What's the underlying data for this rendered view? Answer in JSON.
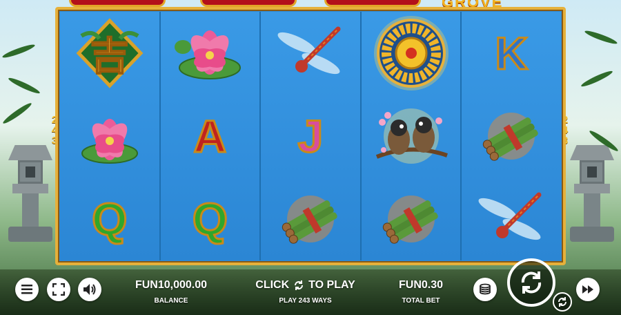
{
  "game": {
    "title_fragment": "GROVE",
    "ways_left": [
      "2",
      "4",
      "3"
    ],
    "ways_right": [
      "2",
      "4",
      "3"
    ]
  },
  "reels": [
    [
      {
        "symbol": "lucky-charm-tile",
        "text": "吉"
      },
      {
        "symbol": "lotus-flower",
        "text": ""
      },
      {
        "symbol": "letter-q",
        "text": "Q"
      }
    ],
    [
      {
        "symbol": "lotus-flower",
        "text": ""
      },
      {
        "symbol": "letter-a",
        "text": "A"
      },
      {
        "symbol": "letter-q",
        "text": "Q"
      }
    ],
    [
      {
        "symbol": "dragonfly",
        "text": ""
      },
      {
        "symbol": "letter-j",
        "text": "J"
      },
      {
        "symbol": "bamboo-bundle",
        "text": ""
      }
    ],
    [
      {
        "symbol": "golden-wheel",
        "text": ""
      },
      {
        "symbol": "birds-on-branch",
        "text": ""
      },
      {
        "symbol": "bamboo-bundle",
        "text": ""
      }
    ],
    [
      {
        "symbol": "letter-k",
        "text": "K"
      },
      {
        "symbol": "bamboo-bundle",
        "text": ""
      },
      {
        "symbol": "dragonfly",
        "text": ""
      }
    ]
  ],
  "controls": {
    "menu_icon": "hamburger-menu-icon",
    "fullscreen_icon": "fullscreen-icon",
    "sound_icon": "speaker-icon",
    "balance_value": "FUN10,000.00",
    "balance_label": "BALANCE",
    "click_text": "CLICK",
    "to_play_text": "TO PLAY",
    "ways_text": "PLAY 243 WAYS",
    "bet_value": "FUN0.30",
    "bet_label": "TOTAL BET",
    "coins_icon": "coin-stack-icon",
    "spin_icon": "spin-arrows-icon",
    "autoplay_icon": "autoplay-icon"
  },
  "colors": {
    "frame_gold": "#e6b13b",
    "reel_blue": "#2e8ad6",
    "text_white": "#ffffff"
  }
}
